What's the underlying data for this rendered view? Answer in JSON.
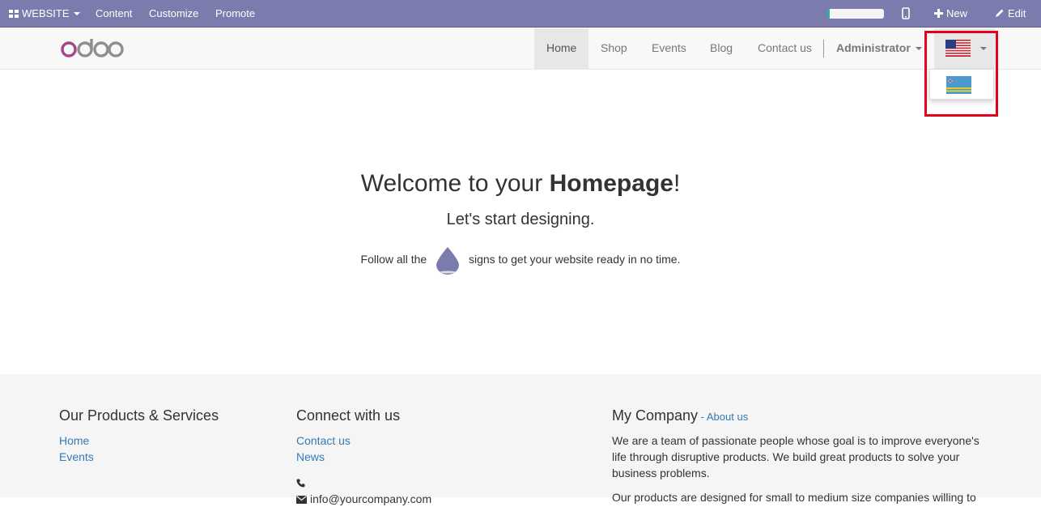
{
  "topbar": {
    "website_label": "WEBSITE",
    "content_label": "Content",
    "customize_label": "Customize",
    "promote_label": "Promote",
    "progress_fraction": 0.04,
    "new_label": "New",
    "edit_label": "Edit",
    "bg_color": "#7c7bad"
  },
  "navbar": {
    "logo_text": "odoo",
    "items": [
      {
        "label": "Home"
      },
      {
        "label": "Shop"
      },
      {
        "label": "Events"
      },
      {
        "label": "Blog"
      },
      {
        "label": "Contact us"
      }
    ],
    "user_label": "Administrator",
    "current_language_icon": "us-flag-icon"
  },
  "language_dropdown": {
    "options": [
      "aruba-flag-icon"
    ]
  },
  "hero": {
    "title_prefix": "Welcome to your ",
    "title_bold": "Homepage",
    "title_suffix": "!",
    "subtitle": "Let's start designing.",
    "follow_prefix": "Follow all the",
    "follow_suffix": "signs to get your website ready in no time."
  },
  "footer": {
    "products": {
      "title": "Our Products & Services",
      "links": [
        "Home",
        "Events"
      ]
    },
    "connect": {
      "title": "Connect with us",
      "links": [
        "Contact us",
        "News"
      ],
      "email": "info@yourcompany.com"
    },
    "company": {
      "title": "My Company",
      "separator": " - ",
      "about_link": "About us",
      "para1": "We are a team of passionate people whose goal is to improve everyone's life through disruptive products. We build great products to solve your business problems.",
      "para2": "Our products are designed for small to medium size companies willing to"
    }
  }
}
